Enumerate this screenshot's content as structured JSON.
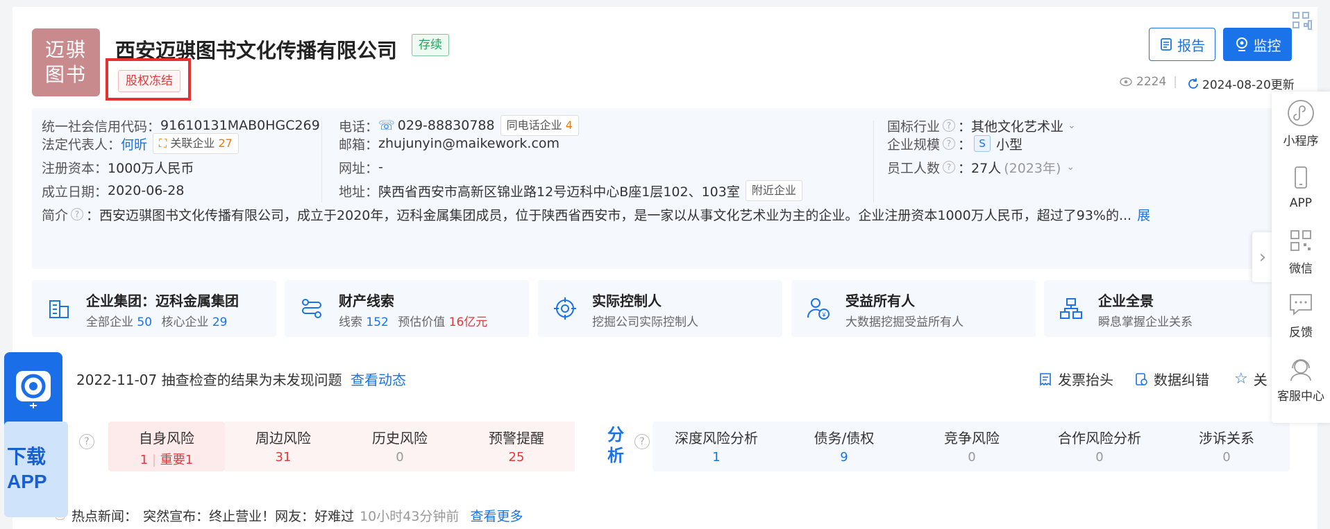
{
  "company": {
    "logo_line1": "迈骐",
    "logo_line2": "图书",
    "name": "西安迈骐图书文化传播有限公司",
    "status": "存续",
    "equity_tag": "股权冻结"
  },
  "actions": {
    "report": "报告",
    "monitor": "监控",
    "views": "2224",
    "updated": "2024-08-20更新"
  },
  "info": {
    "credit_code_label": "统一社会信用代码：",
    "credit_code": "91610131MAB0HGC269",
    "legal_rep_label": "法定代表人：",
    "legal_rep": "何昕",
    "related_label": "关联企业",
    "related_count": "27",
    "capital_label": "注册资本：",
    "capital": "1000万人民币",
    "founded_label": "成立日期：",
    "founded": "2020-06-28",
    "phone_label": "电话：",
    "phone": "029-88830788",
    "same_phone_label": "同电话企业",
    "same_phone_count": "4",
    "email_label": "邮箱：",
    "email": "zhujunyin@maikework.com",
    "website_label": "网址：",
    "website": "-",
    "address_label": "地址：",
    "address": "陕西省西安市高新区锦业路12号迈科中心B座1层102、103室",
    "nearby": "附近企业",
    "industry_label": "国标行业",
    "industry": "：其他文化艺术业",
    "scale_label": "企业规模",
    "scale_badge": "S",
    "scale": "小型",
    "staff_label": "员工人数",
    "staff": "：27人",
    "staff_year": "(2023年)",
    "intro_label": "简介",
    "intro": "：西安迈骐图书文化传播有限公司，成立于2020年，迈科金属集团成员，位于陕西省西安市，是一家以从事文化艺术业为主的企业。企业注册资本1000万人民币，超过了93%的...",
    "intro_more": "展"
  },
  "features": [
    {
      "title": "企业集团：迈科金属集团",
      "sub1": "全部企业",
      "val1": "50",
      "sub2": "核心企业",
      "val2": "29"
    },
    {
      "title": "财产线索",
      "sub1": "线索",
      "val1": "152",
      "sub2": "预估价值",
      "val2": "16亿元"
    },
    {
      "title": "实际控制人",
      "sub": "挖掘公司实际控制人"
    },
    {
      "title": "受益所有人",
      "sub": "大数据挖掘受益所有人"
    },
    {
      "title": "企业全景",
      "sub": "瞬息掌握企业关系"
    }
  ],
  "check": {
    "text": "2022-11-07 抽查检查的结果为未发现问题",
    "link": "查看动态",
    "invoice": "发票抬头",
    "correct": "数据纠错",
    "follow": "关"
  },
  "risk": {
    "self_label": "自身风险",
    "self_val": "1",
    "self_important": "重要1",
    "around_label": "周边风险",
    "around_val": "31",
    "history_label": "历史风险",
    "history_val": "0",
    "warn_label": "预警提醒",
    "warn_val": "25",
    "analysis_label1": "分",
    "analysis_label2": "析",
    "items": [
      {
        "label": "深度风险分析",
        "val": "1"
      },
      {
        "label": "债务/债权",
        "val": "9"
      },
      {
        "label": "竞争风险",
        "val": "0"
      },
      {
        "label": "合作风险分析",
        "val": "0"
      },
      {
        "label": "涉诉关系",
        "val": "0"
      }
    ]
  },
  "news": {
    "label": "热点新闻：",
    "text": "突然宣布：终止营业！网友：好难过",
    "time": "10小时43分钟前",
    "more": "查看更多"
  },
  "sidebar": {
    "mini": "小程序",
    "app": "APP",
    "wechat": "微信",
    "feedback": "反馈",
    "service": "客服中心"
  },
  "download": {
    "line1": "下载",
    "line2": "APP"
  },
  "colors": {
    "primary": "#1a73e8",
    "risk_red": "#e03a3a",
    "logo_bg": "#c98a8d"
  }
}
